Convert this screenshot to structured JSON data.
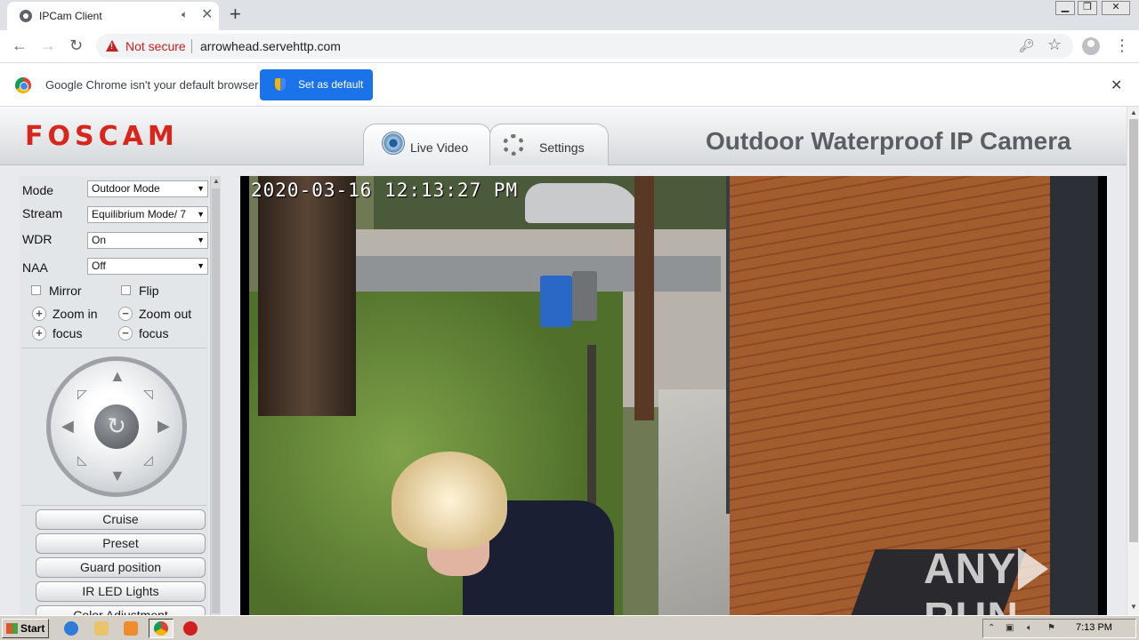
{
  "browser": {
    "tab": {
      "title": "IPCam Client",
      "audio_icon": "speaker-icon",
      "close_glyph": "✕"
    },
    "new_tab_glyph": "+",
    "window_controls": [
      "minimize",
      "restore",
      "close"
    ],
    "address": {
      "security_label": "Not secure",
      "url": "arrowhead.servehttp.com"
    },
    "infobar": {
      "message": "Google Chrome isn't your default browser",
      "button_label": "Set as default",
      "close_glyph": "✕"
    }
  },
  "foscam": {
    "logo": "FOSCAM",
    "tabs": [
      {
        "label": "Live Video",
        "icon": "camera-icon",
        "active": true
      },
      {
        "label": "Settings",
        "icon": "gear-icon",
        "active": false
      }
    ],
    "product_title": "Outdoor Waterproof IP Camera",
    "controls": {
      "mode": {
        "label": "Mode",
        "value": "Outdoor Mode"
      },
      "stream": {
        "label": "Stream",
        "value": "Equilibrium Mode/ 7"
      },
      "wdr": {
        "label": "WDR",
        "value": "On"
      },
      "naa": {
        "label": "NAA",
        "value": "Off"
      },
      "mirror_label": "Mirror",
      "flip_label": "Flip",
      "zoom_in_label": "Zoom in",
      "zoom_out_label": "Zoom out",
      "focus_in_label": "focus",
      "focus_out_label": "focus"
    },
    "buttons": [
      "Cruise",
      "Preset",
      "Guard position",
      "IR LED Lights",
      "Color Adjustment"
    ],
    "video": {
      "timestamp": "2020-03-16 12:13:27 PM",
      "watermark": "ANY RUN"
    }
  },
  "taskbar": {
    "start_label": "Start",
    "clock": "7:13 PM"
  },
  "colors": {
    "accent": "#1a73e8",
    "brand": "#d9261c",
    "warning": "#c5221f"
  }
}
